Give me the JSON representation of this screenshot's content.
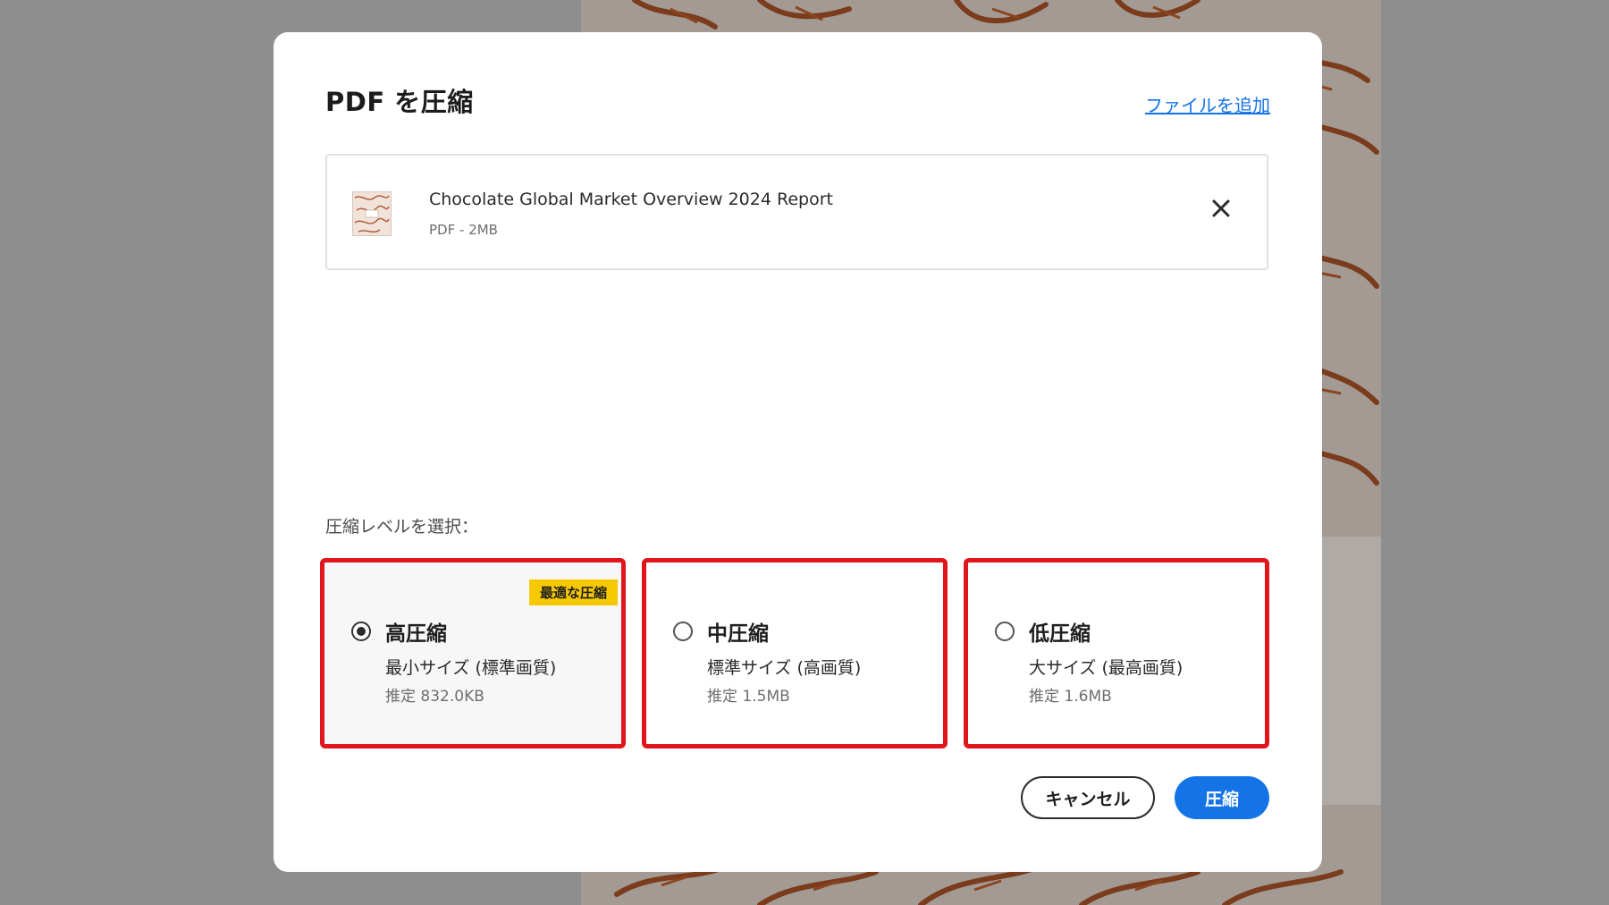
{
  "dialog": {
    "title": "PDF を圧縮",
    "add_file_link": "ファイルを追加"
  },
  "file": {
    "name": "Chocolate Global Market Overview 2024 Report",
    "meta": "PDF - 2MB",
    "thumbnail_icon": "pdf-thumbnail-icon",
    "remove_icon": "close-icon"
  },
  "compression": {
    "label": "圧縮レベルを選択：",
    "selected_index": 0,
    "options": [
      {
        "title": "高圧縮",
        "description": "最小サイズ (標準画質)",
        "estimate": "推定 832.0KB",
        "badge": "最適な圧縮"
      },
      {
        "title": "中圧縮",
        "description": "標準サイズ (高画質)",
        "estimate": "推定 1.5MB"
      },
      {
        "title": "低圧縮",
        "description": "大サイズ (最高画質)",
        "estimate": "推定 1.6MB"
      }
    ]
  },
  "buttons": {
    "cancel": "キャンセル",
    "compress": "圧縮"
  },
  "colors": {
    "accent": "#1473e6",
    "highlight_border": "#e0161c",
    "badge": "#f5c800",
    "overlay": "#8e8e8e",
    "background_art": "#a04a1e"
  }
}
